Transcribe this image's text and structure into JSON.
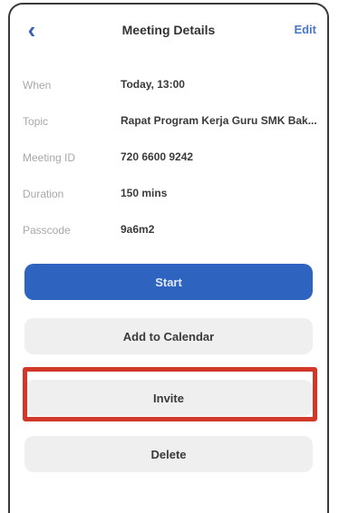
{
  "header": {
    "back_icon": "chevron-left-icon",
    "back_glyph": "‹",
    "title": "Meeting Details",
    "edit_label": "Edit"
  },
  "details": [
    {
      "label": "When",
      "value": "Today, 13:00"
    },
    {
      "label": "Topic",
      "value": "Rapat Program Kerja Guru SMK Bak..."
    },
    {
      "label": "Meeting ID",
      "value": "720 6600 9242"
    },
    {
      "label": "Duration",
      "value": "150 mins"
    },
    {
      "label": "Passcode",
      "value": "9a6m2"
    }
  ],
  "actions": {
    "start_label": "Start",
    "calendar_label": "Add to Calendar",
    "invite_label": "Invite",
    "delete_label": "Delete"
  },
  "colors": {
    "accent": "#2e64c0",
    "highlight": "#d2382a",
    "secondary_button": "#efefef"
  }
}
